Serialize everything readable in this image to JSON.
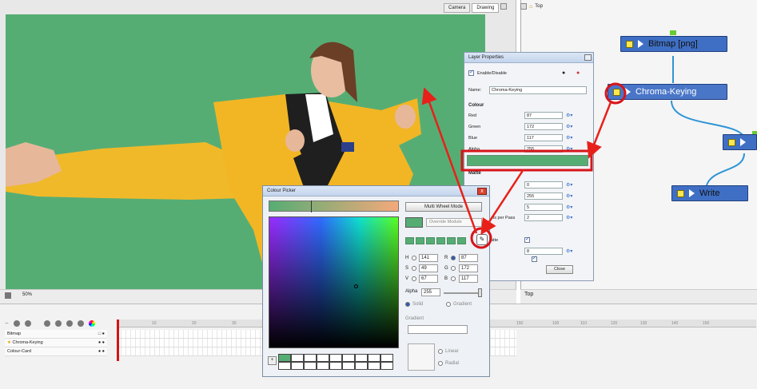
{
  "camera": {
    "tabs": [
      "Camera",
      "Drawing"
    ],
    "zoom": "50%"
  },
  "node_view": {
    "header": "Top",
    "footer_title": "Top",
    "nodes": {
      "bitmap": "Bitmap [png]",
      "chroma": "Chroma-Keying",
      "write": "Write"
    }
  },
  "timeline": {
    "ruler": [
      "10",
      "20",
      "30",
      "150",
      "100",
      "110",
      "120",
      "130",
      "140",
      "150"
    ],
    "layers": [
      "Bitmap",
      "Chroma-Keying",
      "Colour-Card"
    ]
  },
  "layer_properties": {
    "title": "Layer Properties",
    "enable_label": "Enable/Disable",
    "name_label": "Name:",
    "name_value": "Chroma-Keying",
    "colour_section": "Colour",
    "red_label": "Red",
    "red_value": "87",
    "green_label": "Green",
    "green_value": "172",
    "blue_label": "Blue",
    "blue_value": "117",
    "alpha_label": "Alpha",
    "alpha_value": "255",
    "swatch_color": "#56ad74",
    "matte_section": "Matte",
    "matte_values": [
      "0",
      "255",
      "5",
      "2",
      "",
      "8"
    ],
    "pixels_per_pass_label": "els per Pass",
    "matte_check_label": "atte",
    "close_label": "Close"
  },
  "colour_picker": {
    "title": "Colour Picker",
    "close_glyph": "x",
    "multi_wheel_label": "Multi Wheel Mode",
    "override_label": "Override Module",
    "h_label": "H",
    "h_value": "141",
    "s_label": "S",
    "s_value": "49",
    "v_label": "V",
    "v_value": "67",
    "r_label": "R",
    "r_value": "87",
    "g_label": "G",
    "g_value": "172",
    "b_label": "B",
    "b_value": "117",
    "alpha_label": "Alpha",
    "alpha_value": "255",
    "solid_label": "Solid",
    "gradient_label": "Gradient",
    "gradient_title": "Gradient",
    "linear_label": "Linear",
    "radial_label": "Radial",
    "expand_glyph": "+",
    "current_color": "#56ad74"
  },
  "colors": {
    "key_green": "#56ad74",
    "node_blue": "#3f6fc4",
    "annotation_red": "#e8201a"
  }
}
